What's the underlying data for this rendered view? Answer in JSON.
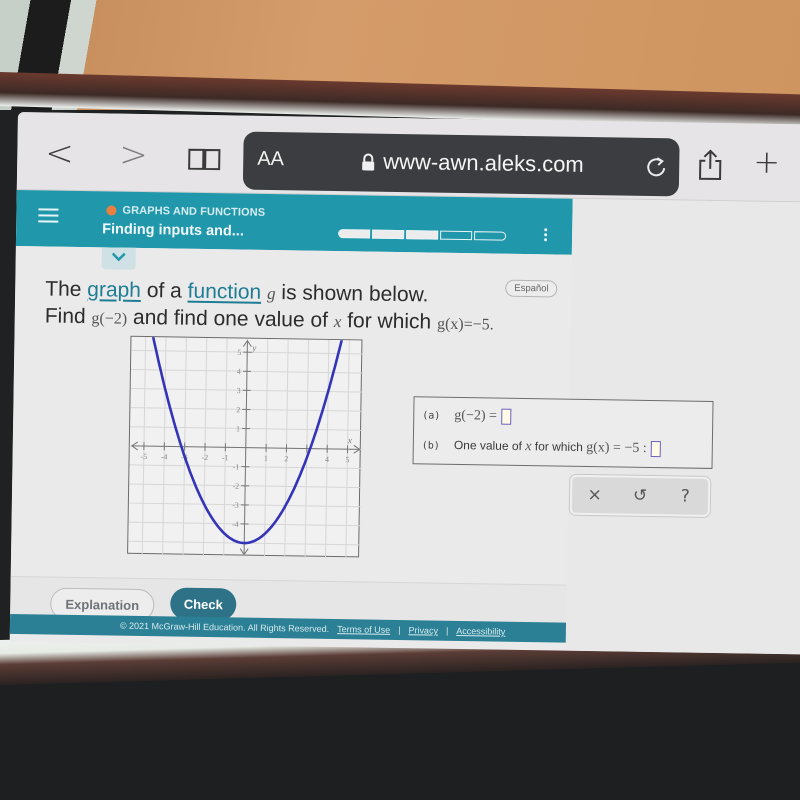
{
  "browser": {
    "text_size_label": "AA",
    "url": "www-awn.aleks.com",
    "icons": {
      "back": "chevron-left-icon",
      "forward": "chevron-right-icon",
      "bookmarks": "book-icon",
      "lock": "lock-icon",
      "reload": "reload-icon",
      "share": "share-icon",
      "new_tab": "plus-icon"
    },
    "back_glyph": "<",
    "forward_glyph": ">",
    "new_tab_glyph": "+"
  },
  "header": {
    "topic": "GRAPHS AND FUNCTIONS",
    "lesson": "Finding inputs and...",
    "progress": {
      "filled_segments": 3,
      "total_segments": 5
    },
    "accent_color": "#2197ab",
    "topic_dot_color": "#e9803f"
  },
  "question": {
    "espanol_label": "Español",
    "line1": {
      "t1": "The ",
      "link1": "graph",
      "t2": " of a ",
      "link2": "function",
      "t3": " ",
      "var": "g",
      "t4": " is shown below."
    },
    "line2": {
      "t1": "Find ",
      "expr1": "g(−2)",
      "t2": " and find one value of ",
      "var": "x",
      "t3": " for which ",
      "expr2": "g(x)=−5."
    }
  },
  "chart_data": {
    "type": "line",
    "title": "",
    "xlabel": "x",
    "ylabel": "y",
    "xlim": [
      -5.5,
      5.5
    ],
    "ylim": [
      -5.5,
      5.5
    ],
    "x_ticks": [
      -5,
      -4,
      -3,
      -2,
      -1,
      1,
      2,
      3,
      4,
      5
    ],
    "x_tick_labels": [
      "-5",
      "-4",
      "-3",
      "-2",
      "-1",
      "1",
      "2",
      "4",
      "5"
    ],
    "y_ticks": [
      -5,
      -4,
      -3,
      -2,
      -1,
      1,
      2,
      3,
      4,
      5
    ],
    "y_tick_labels": [
      "5",
      "4",
      "3",
      "2",
      "1",
      "-1",
      "-2",
      "-3",
      "-4"
    ],
    "grid": true,
    "series": [
      {
        "name": "g",
        "color": "#3434b8",
        "function": "0.5*x^2 - 5",
        "vertex": [
          0,
          -5
        ],
        "x": [
          -4.8,
          -4,
          -3,
          -2,
          -1,
          0,
          1,
          2,
          3,
          4,
          4.6
        ],
        "y": [
          6.52,
          3,
          -0.5,
          -3,
          -4.5,
          -5,
          -4.5,
          -3,
          -0.5,
          3,
          5.58
        ]
      }
    ]
  },
  "answers": {
    "a": {
      "part_label": "(a)",
      "expr": "g(−2) =",
      "value": ""
    },
    "b": {
      "part_label": "(b)",
      "text": "One value of ",
      "var": "x",
      "text2": " for which ",
      "expr": "g(x) = −5 :",
      "value": ""
    }
  },
  "tools": {
    "clear": "×",
    "undo": "↺",
    "help": "?"
  },
  "actions": {
    "explanation": "Explanation",
    "check": "Check"
  },
  "footer": {
    "copyright": "© 2021 McGraw-Hill Education. All Rights Reserved.",
    "links": [
      "Terms of Use",
      "Privacy",
      "Accessibility"
    ],
    "separator": "|"
  }
}
